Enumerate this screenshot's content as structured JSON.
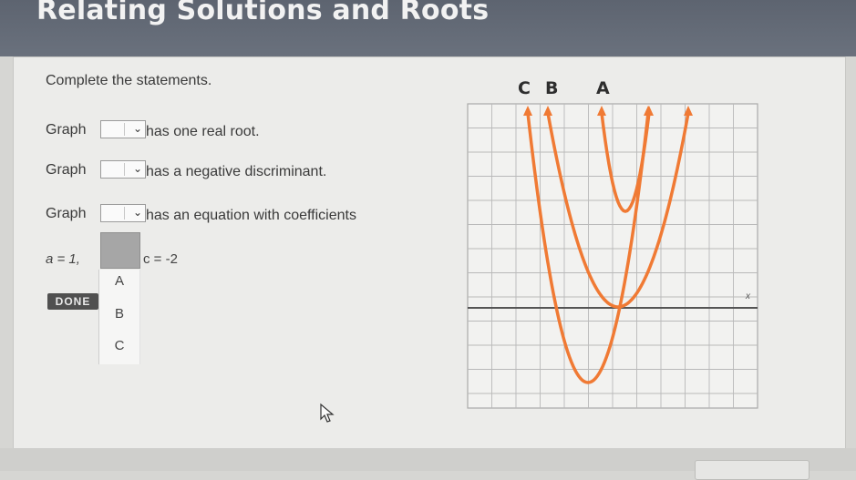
{
  "header": {
    "title": "Relating Solutions and Roots"
  },
  "prompt": "Complete the statements.",
  "statements": [
    {
      "prefix": "Graph",
      "suffix": "has one real root."
    },
    {
      "prefix": "Graph",
      "suffix": "has a negative discriminant."
    },
    {
      "prefix": "Graph",
      "suffix": "has an equation with coefficients"
    }
  ],
  "equation": {
    "a_text": "a = 1, ",
    "c_text": "c = -2"
  },
  "dropdown_menu": {
    "options": [
      "A",
      "B",
      "C"
    ]
  },
  "done_label": "DONE",
  "graph": {
    "labels": [
      "C",
      "B",
      "A"
    ],
    "x_axis_label": "x",
    "curve_color": "#f07a34"
  }
}
